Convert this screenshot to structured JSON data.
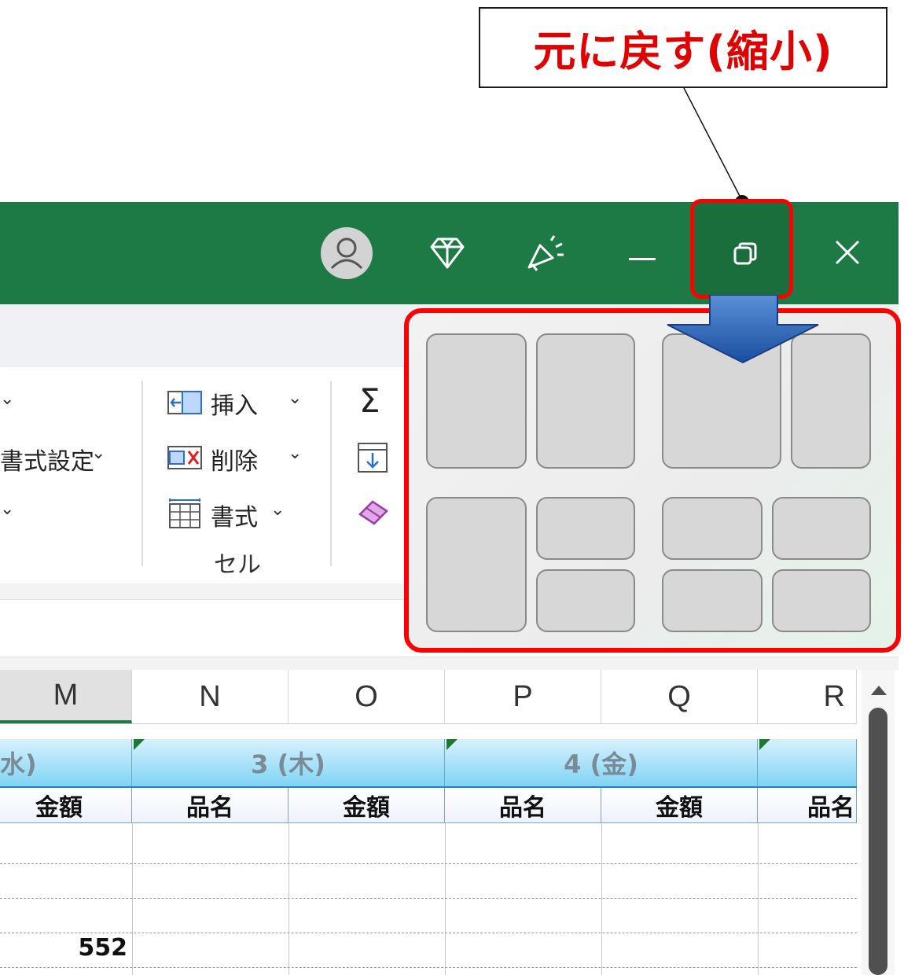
{
  "callout": {
    "text": "元に戻す(縮小)"
  },
  "titlebar": {
    "avatar_icon": "user-avatar-icon",
    "premium_icon": "diamond-icon",
    "coauthor_icon": "megaphone-icon",
    "minimize_icon": "minimize-icon",
    "restore_icon": "restore-down-icon",
    "close_icon": "close-icon",
    "bg_color": "#1e7a44",
    "highlight_color": "#ff0000"
  },
  "ribbon": {
    "format_setting_label": "書式設定",
    "insert_label": "挿入",
    "delete_label": "削除",
    "format_label": "書式",
    "cells_group_label": "セル",
    "sum_symbol": "Σ"
  },
  "snap_layouts": {
    "options": [
      "two-equal",
      "two-wide-left",
      "one-left-two-right",
      "four-quadrants"
    ]
  },
  "sheet": {
    "columns": [
      "M",
      "N",
      "O",
      "P",
      "Q",
      "R"
    ],
    "day_headers": [
      "水)",
      "3 (木)",
      "4 (金)"
    ],
    "sub_headers": [
      "金額",
      "品名",
      "金額",
      "品名",
      "金額",
      "品名"
    ],
    "value_m": "552"
  }
}
